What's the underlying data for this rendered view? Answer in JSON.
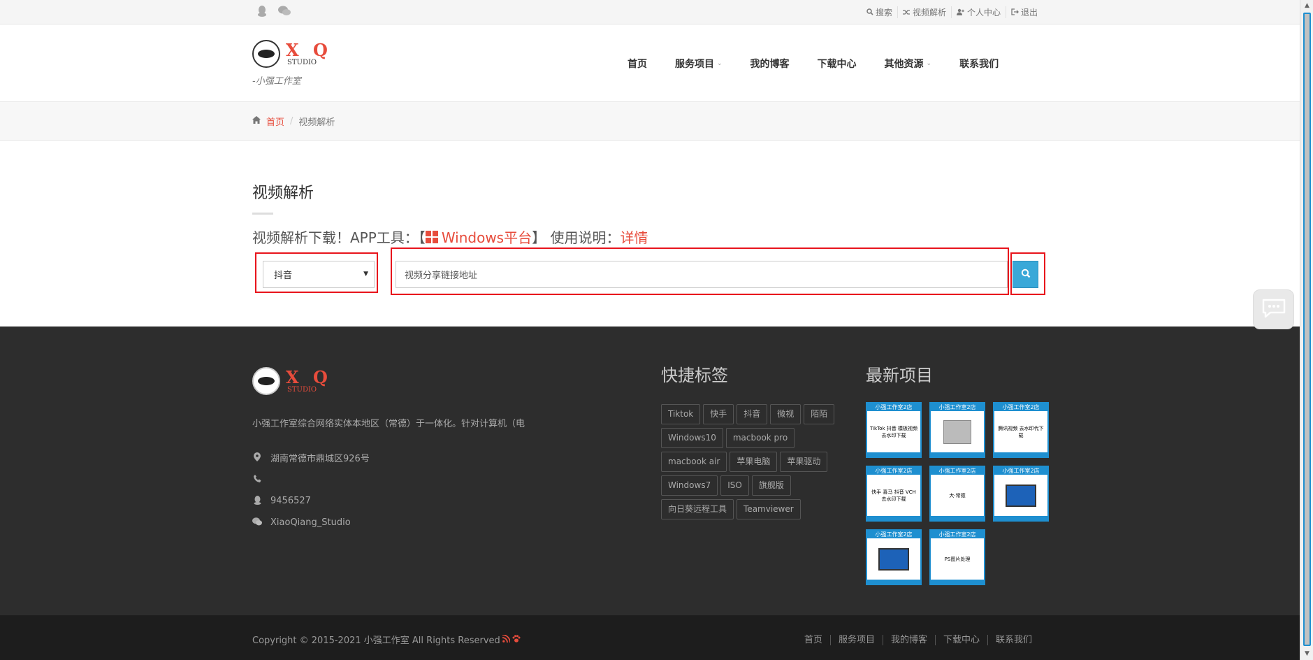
{
  "topbar": {
    "social": [
      "qq-icon",
      "wechat-icon"
    ],
    "links": [
      {
        "icon": "search-icon",
        "label": "搜索"
      },
      {
        "icon": "shuffle-icon",
        "label": "视频解析"
      },
      {
        "icon": "users-icon",
        "label": "个人中心"
      },
      {
        "icon": "sign-out-icon",
        "label": "退出"
      }
    ]
  },
  "header": {
    "logo_text": "X Q",
    "logo_sub": "STUDIO",
    "slogan": "-小强工作室",
    "nav": [
      {
        "label": "首页",
        "has_dropdown": false
      },
      {
        "label": "服务项目",
        "has_dropdown": true
      },
      {
        "label": "我的博客",
        "has_dropdown": false
      },
      {
        "label": "下载中心",
        "has_dropdown": false
      },
      {
        "label": "其他资源",
        "has_dropdown": true
      },
      {
        "label": "联系我们",
        "has_dropdown": false
      }
    ]
  },
  "breadcrumb": {
    "home": "首页",
    "sep": "/",
    "current": "视频解析"
  },
  "main": {
    "title": "视频解析",
    "notice_prefix": "视频解析下载！APP工具：【",
    "notice_windows": "Windows平台",
    "notice_middle": "】 使用说明：",
    "notice_detail": "详情",
    "platform_value": "抖音",
    "url_placeholder": "视频分享链接地址",
    "highlight_color": "#e8141c"
  },
  "footer": {
    "logo_text": "X Q",
    "logo_sub": "STUDIO",
    "description": "小强工作室综合网络实体本地区（常德）于一体化。针对计算机（电",
    "contact": {
      "address": "湖南常德市鼎城区926号",
      "phone": "",
      "qq": "9456527",
      "wechat": "XiaoQiang_Studio"
    },
    "tags_title": "快捷标签",
    "tags": [
      "Tiktok",
      "快手",
      "抖音",
      "微视",
      "陌陌",
      "Windows10",
      "macbook pro",
      "macbook air",
      "苹果电脑",
      "苹果驱动",
      "Windows7",
      "ISO",
      "旗舰版",
      "向日葵远程工具",
      "Teamviewer"
    ],
    "projects_title": "最新项目",
    "projects": [
      {
        "banner": "小强工作室2店",
        "text": "TikTok 抖音 模板视频 去水印下载",
        "kind": "text"
      },
      {
        "banner": "小强工作室2店",
        "text": "",
        "kind": "hdd"
      },
      {
        "banner": "小强工作室2店",
        "text": "腾讯视频 去水印代下载",
        "kind": "text"
      },
      {
        "banner": "小强工作室2店",
        "text": "快手 喜马 抖音 VCH 去水印下载",
        "kind": "text"
      },
      {
        "banner": "小强工作室2店",
        "text": "大·常德",
        "kind": "text"
      },
      {
        "banner": "小强工作室2店",
        "text": "",
        "kind": "monitor"
      },
      {
        "banner": "小强工作室2店",
        "text": "",
        "kind": "monitor"
      },
      {
        "banner": "小强工作室2店",
        "text": "PS图片处理",
        "kind": "text"
      }
    ]
  },
  "bottom": {
    "copyright": "Copyright © 2015-2021 小强工作室 All Rights Reserved",
    "links": [
      "首页",
      "服务项目",
      "我的博客",
      "下载中心",
      "联系我们"
    ]
  }
}
